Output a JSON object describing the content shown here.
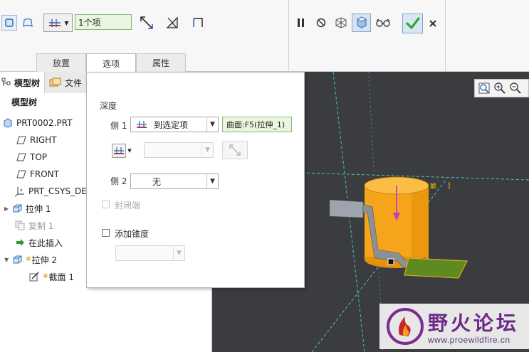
{
  "ribbon": {
    "ref_count_field": "1个项",
    "tabs": [
      {
        "label": "放置"
      },
      {
        "label": "选项"
      },
      {
        "label": "属性"
      }
    ]
  },
  "left_panel": {
    "tabs": [
      {
        "label": "模型树"
      },
      {
        "label": "文件"
      }
    ],
    "header": "模型树",
    "tree": [
      {
        "label": "PRT0002.PRT",
        "icon": "part-icon"
      },
      {
        "label": "RIGHT",
        "icon": "datum-plane-icon"
      },
      {
        "label": "TOP",
        "icon": "datum-plane-icon"
      },
      {
        "label": "FRONT",
        "icon": "datum-plane-icon"
      },
      {
        "label": "PRT_CSYS_DEF",
        "icon": "csys-icon"
      },
      {
        "label": "拉伸 1",
        "icon": "extrude-icon"
      },
      {
        "label": "复制 1",
        "icon": "copy-icon"
      },
      {
        "label": "在此插入",
        "icon": "insert-arrow-icon"
      },
      {
        "label": "拉伸 2",
        "icon": "extrude-icon"
      },
      {
        "label": "截面 1",
        "icon": "sketch-icon"
      }
    ]
  },
  "options": {
    "depth_label": "深度",
    "side1_label": "侧 1",
    "side1_value": "到选定项",
    "side1_ref": "曲面:F5(拉伸_1)",
    "side2_label": "侧 2",
    "side2_value": "无",
    "capped_ends_label": "封闭端",
    "add_taper_label": "添加锥度"
  },
  "viewport": {
    "dim_label": "颠",
    "watermark_title": "野火论坛",
    "watermark_url": "www.proewildfire.cn"
  },
  "colors": {
    "accent_green": "#2fa92f",
    "part_orange": "#f7a31a",
    "viewport_bg": "#3b3c3f"
  }
}
